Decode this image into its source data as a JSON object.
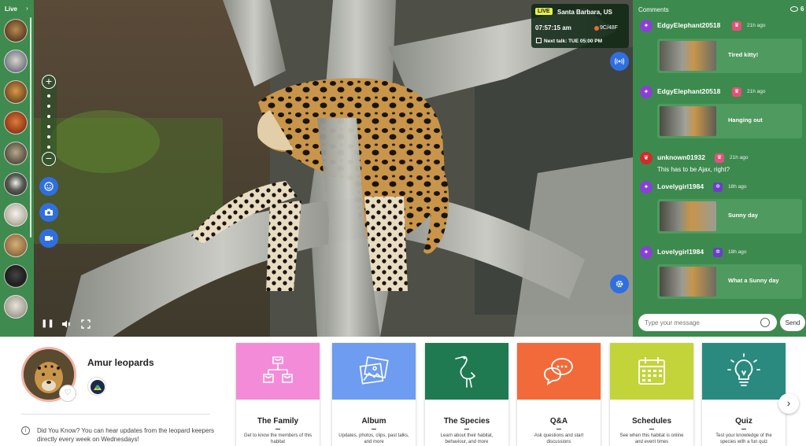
{
  "sidebar": {
    "live_label": "Live",
    "thumbs": [
      "Amur leopards",
      "Tigers",
      "Red pandas",
      "Orangutans",
      "Koalas",
      "Lemurs",
      "Wolves",
      "Lions",
      "Gorillas",
      "Snow leopards"
    ]
  },
  "info": {
    "live_badge": "LIVE",
    "location": "Santa Barbara, US",
    "time": "07:57:15 am",
    "temp": "9C/48F",
    "next_talk": "Next talk: TUE 05:00 PM"
  },
  "comments": {
    "title": "Comments",
    "viewers": "6",
    "items": [
      {
        "user": "EdgyElephant20518",
        "time": "21h ago",
        "card": "Tired kitty!",
        "avatar_color": "#8a3fd6"
      },
      {
        "user": "EdgyElephant20518",
        "time": "21h ago",
        "card": "Hanging out",
        "avatar_color": "#8a3fd6"
      },
      {
        "user": "unknown01932",
        "time": "21h ago",
        "text": "This has to be Ajax, right?",
        "avatar_color": "#d12b2b"
      },
      {
        "user": "Lovelygirl1984",
        "time": "18h ago",
        "card": "Sunny day",
        "avatar_color": "#8a3fd6"
      },
      {
        "user": "Lovelygirl1984",
        "time": "18h ago",
        "card": "What a Sunny day",
        "avatar_color": "#8a3fd6"
      }
    ],
    "input_placeholder": "Type your message",
    "send_label": "Send"
  },
  "habitat": {
    "name": "Amur leopards",
    "did_you_know": "Did You Know? You can hear updates from the leopard keepers directly every week on Wednesdays!"
  },
  "cards": [
    {
      "title": "The Family",
      "desc": "Get to know the members of this habitat",
      "color": "#f38bd9",
      "icon": "family-tree-icon"
    },
    {
      "title": "Album",
      "desc": "Updates, photos, clips, past talks, and more",
      "color": "#6d9cf0",
      "icon": "photo-album-icon"
    },
    {
      "title": "The Species",
      "desc": "Learn about their habitat, behaviour, and more",
      "color": "#1f7a52",
      "icon": "heron-icon"
    },
    {
      "title": "Q&A",
      "desc": "Ask questions and start discussions",
      "color": "#f26a3a",
      "icon": "chat-bubbles-icon"
    },
    {
      "title": "Schedules",
      "desc": "See when this habitat is online and event times",
      "color": "#c3d43b",
      "icon": "calendar-icon"
    },
    {
      "title": "Quiz",
      "desc": "Test your knowledge of the species with a fun quiz",
      "color": "#2a8a80",
      "icon": "lightbulb-icon"
    }
  ],
  "colors": {
    "sidebar": "#3f8a4e",
    "comments_bg": "#3d8a4e",
    "accent_blue": "#2f6fe0"
  }
}
